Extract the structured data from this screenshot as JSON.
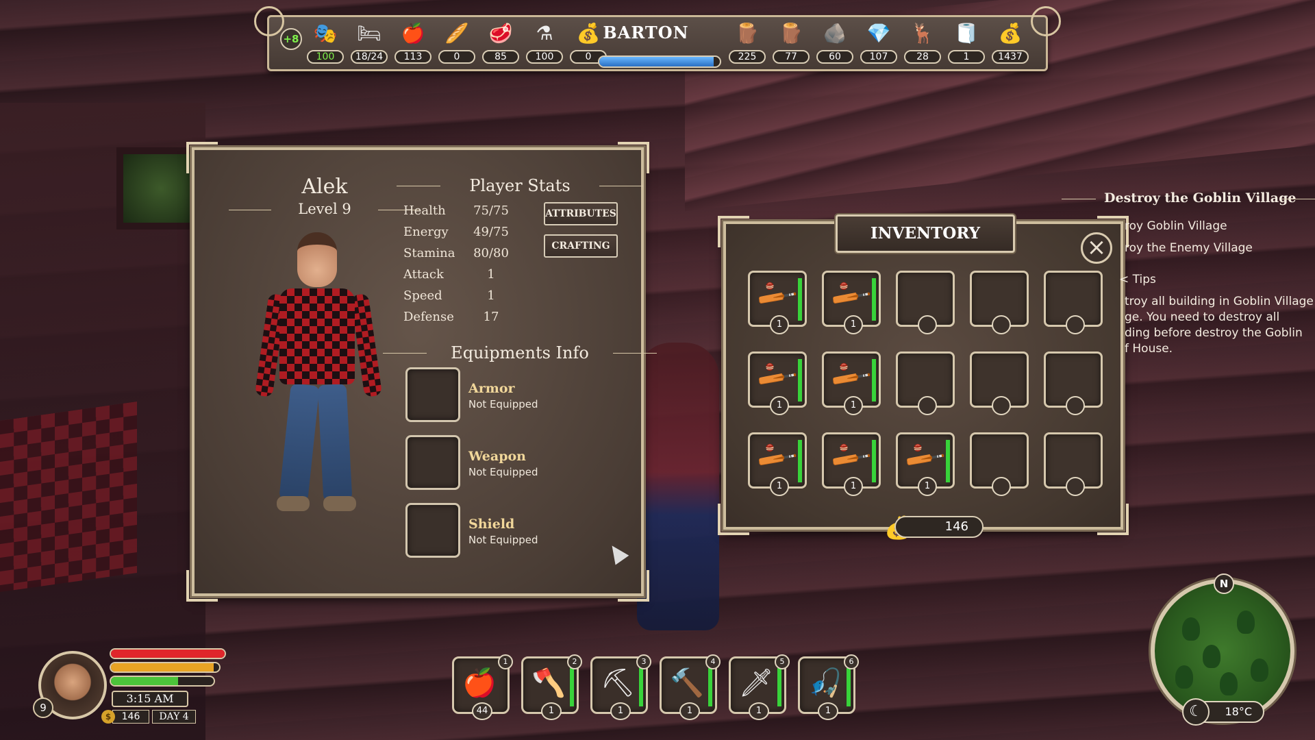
{
  "top_bar": {
    "bonus": "+8",
    "town_name": "BARTON",
    "town_progress": 0.95,
    "resources": [
      {
        "name": "happiness",
        "icon": "theater-mask-icon",
        "glyph": "🎭",
        "value": "100",
        "highlight": true
      },
      {
        "name": "beds",
        "icon": "bed-icon",
        "glyph": "🛏",
        "value": "18/24"
      },
      {
        "name": "food",
        "icon": "apple-icon",
        "glyph": "🍎",
        "value": "113"
      },
      {
        "name": "bread",
        "icon": "bread-icon",
        "glyph": "🥖",
        "value": "0"
      },
      {
        "name": "meat",
        "icon": "meat-icon",
        "glyph": "🥩",
        "value": "85"
      },
      {
        "name": "potion",
        "icon": "potion-icon",
        "glyph": "⚗",
        "value": "100"
      },
      {
        "name": "sack",
        "icon": "sack-icon",
        "glyph": "💰",
        "value": "0"
      },
      {
        "name": "logs",
        "icon": "log-icon",
        "glyph": "🪵",
        "value": "225"
      },
      {
        "name": "planks",
        "icon": "plank-icon",
        "glyph": "🪵",
        "value": "77"
      },
      {
        "name": "stone",
        "icon": "stone-icon",
        "glyph": "🪨",
        "value": "60"
      },
      {
        "name": "iron",
        "icon": "ingot-icon",
        "glyph": "💎",
        "value": "107"
      },
      {
        "name": "hide",
        "icon": "hide-icon",
        "glyph": "🦌",
        "value": "28"
      },
      {
        "name": "cloth",
        "icon": "cloth-roll-icon",
        "glyph": "🧻",
        "value": "1"
      },
      {
        "name": "gold",
        "icon": "gold-bag-icon",
        "glyph": "💰",
        "value": "1437"
      }
    ]
  },
  "player": {
    "name": "Alek",
    "level": "Level 9",
    "stats_title": "Player Stats",
    "stats": [
      {
        "label": "Health",
        "value": "75/75"
      },
      {
        "label": "Energy",
        "value": "49/75"
      },
      {
        "label": "Stamina",
        "value": "80/80"
      },
      {
        "label": "Attack",
        "value": "1"
      },
      {
        "label": "Speed",
        "value": "1"
      },
      {
        "label": "Defense",
        "value": "17"
      }
    ],
    "attributes_button": "ATTRIBUTES",
    "crafting_button": "CRAFTING",
    "equip_title": "Equipments Info",
    "equipment": [
      {
        "name": "Armor",
        "status": "Not Equipped"
      },
      {
        "name": "Weapon",
        "status": "Not Equipped"
      },
      {
        "name": "Shield",
        "status": "Not Equipped"
      }
    ]
  },
  "inventory": {
    "title": "INVENTORY",
    "gold": "146",
    "slots": [
      {
        "item": "club",
        "count": "1",
        "durability": 1.0
      },
      {
        "item": "club",
        "count": "1",
        "durability": 1.0
      },
      {
        "item": null
      },
      {
        "item": null
      },
      {
        "item": null
      },
      {
        "item": "club",
        "count": "1",
        "durability": 1.0
      },
      {
        "item": "club",
        "count": "1",
        "durability": 1.0
      },
      {
        "item": null
      },
      {
        "item": null
      },
      {
        "item": null
      },
      {
        "item": "club",
        "count": "1",
        "durability": 1.0
      },
      {
        "item": "club",
        "count": "1",
        "durability": 1.0
      },
      {
        "item": "club",
        "count": "1",
        "durability": 1.0
      },
      {
        "item": null
      },
      {
        "item": null
      }
    ]
  },
  "quest": {
    "title": "Destroy the Goblin Village",
    "lines": [
      "roy Goblin Village",
      "roy the Enemy Village",
      "< Tips",
      "troy all building in Goblin Village",
      "ge. You need to destroy all",
      "ding before destroy the Goblin",
      "f House."
    ]
  },
  "hud": {
    "level": "9",
    "health": 1.0,
    "stamina": 0.95,
    "energy": 0.65,
    "time": "3:15 AM",
    "coins": "146",
    "day": "DAY 4",
    "colors": {
      "health": "#e0262b",
      "stamina": "#e8a324",
      "energy": "#4cc43a"
    }
  },
  "hotbar": [
    {
      "slot": "1",
      "item": "apple",
      "icon": "apple-icon",
      "glyph": "🍎",
      "count": "44",
      "durability": null
    },
    {
      "slot": "2",
      "item": "axe",
      "icon": "axe-icon",
      "glyph": "🪓",
      "count": "1",
      "durability": 1.0
    },
    {
      "slot": "3",
      "item": "pickaxe",
      "icon": "pickaxe-icon",
      "glyph": "⛏",
      "count": "1",
      "durability": 1.0
    },
    {
      "slot": "4",
      "item": "hammer",
      "icon": "hammer-icon",
      "glyph": "🔨",
      "count": "1",
      "durability": 1.0
    },
    {
      "slot": "5",
      "item": "spear",
      "icon": "spear-icon",
      "glyph": "🗡",
      "count": "1",
      "durability": 1.0
    },
    {
      "slot": "6",
      "item": "fishing rod",
      "icon": "fishing-rod-icon",
      "glyph": "🎣",
      "count": "1",
      "durability": 1.0
    }
  ],
  "minimap": {
    "north": "N",
    "temperature": "18°C"
  }
}
